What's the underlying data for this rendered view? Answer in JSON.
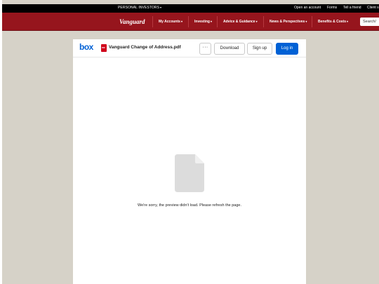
{
  "topbar": {
    "persona": "PERSONAL INVESTORS",
    "utility_links": [
      "Open an account",
      "Forms",
      "Tell a friend",
      "Client s"
    ]
  },
  "navbar": {
    "logo": "Vanguard",
    "items": [
      "My Accounts",
      "Investing",
      "Advice & Guidance",
      "News & Perspectives",
      "Benefits & Costs"
    ],
    "search_placeholder": "Search/"
  },
  "viewer": {
    "brand": "box",
    "file_badge": "PDF",
    "file_name": "Vanguard Change of Address.pdf",
    "more_label": "···",
    "download_label": "Download",
    "signup_label": "Sign up",
    "login_label": "Log in",
    "error_message": "We're sorry, the preview didn't load. Please refresh the page."
  },
  "colors": {
    "vanguard_red": "#96151d",
    "box_blue": "#0061d5",
    "page_bg": "#d6d2c8"
  }
}
